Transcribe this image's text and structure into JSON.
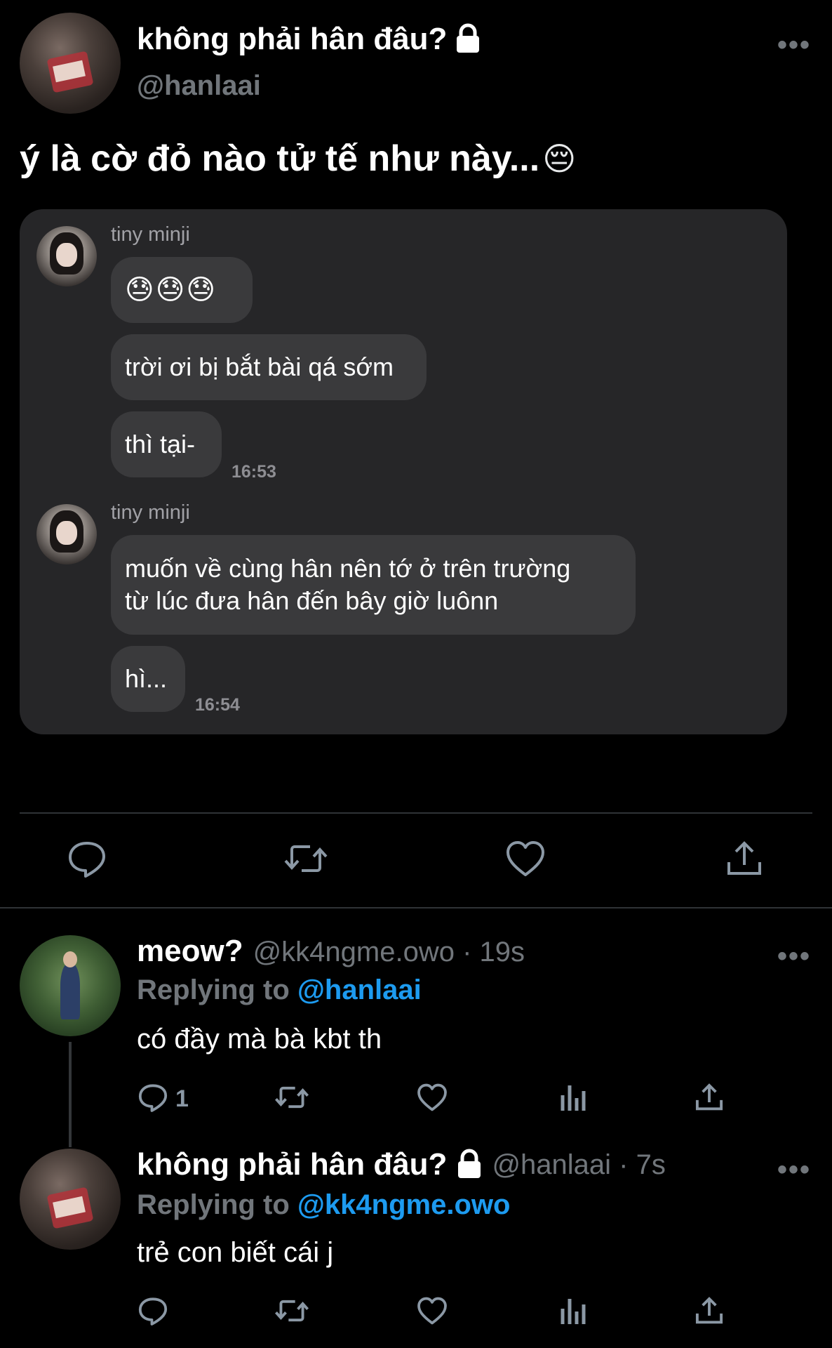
{
  "main_tweet": {
    "display_name": "không phải hân đâu?",
    "handle": "@hanlaai",
    "more": "•••",
    "text": "ý là cờ đỏ nào tử tế như này...",
    "text_emoji": "😔"
  },
  "dm_screenshot": {
    "groups": [
      {
        "sender": "tiny minji",
        "messages": [
          "😓😓😓",
          "trời ơi bị bắt bài qá sớm",
          "thì tại-"
        ],
        "time": "16:53"
      },
      {
        "sender": "tiny minji",
        "messages": [
          [
            "muốn về cùng hân nên tớ ở trên trường",
            "từ lúc đưa hân đến bây giờ luônn"
          ],
          "hì..."
        ],
        "time": "16:54"
      }
    ]
  },
  "actions": [
    "reply-icon",
    "retweet-icon",
    "like-icon",
    "share-icon"
  ],
  "replies": [
    {
      "display_name": "meow?",
      "handle_time": "@kk4ngme.owo · 19s",
      "replying_prefix": "Replying to",
      "replying_to": "@hanlaai",
      "text": "có đầy mà bà kbt th",
      "reply_count": "1",
      "more": "•••"
    },
    {
      "display_name": "không phải hân đâu?",
      "handle_time": "@hanlaai · 7s",
      "replying_prefix": "Replying to",
      "replying_to": "@kk4ngme.owo",
      "text": "trẻ con biết cái j",
      "reply_count": "",
      "more": "•••"
    }
  ],
  "colors": {
    "background": "#000000",
    "text": "#ffffff",
    "secondary": "#71767b",
    "mention": "#1d9bf0",
    "card": "#262628",
    "bubble": "#3a3a3c"
  }
}
